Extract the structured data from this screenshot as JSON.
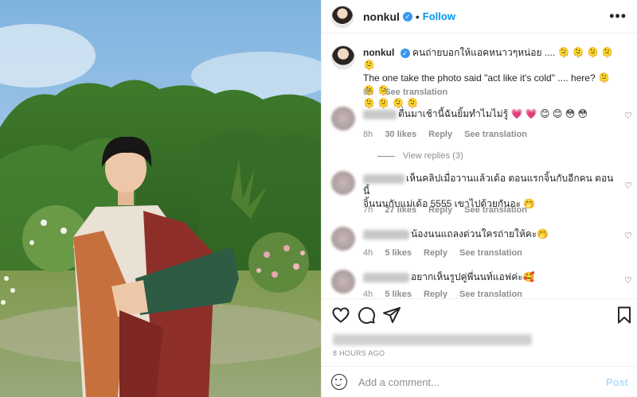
{
  "header": {
    "username": "nonkul",
    "verified_mark": "✓",
    "separator": "•",
    "follow_label": "Follow",
    "more_label": "•••"
  },
  "caption": {
    "username": "nonkul",
    "line1": "คนถ่ายบอกให้แอคหนาวๆหน่อย .... 🫠 🫠 🫠 🫠 🫠",
    "line2": "The one take the photo said \"act like it's cold\" .... here? 🫠 🫠 🫠",
    "line3": "🫠 🫠 🫠 🫠",
    "time": "8h",
    "see_translation": "See translation"
  },
  "comments": [
    {
      "text": "ตื่นมาเช้านี้ฉันยิ้มทำไมไม่รู้ 💗 💗 😊 😊 😳 😳",
      "time": "8h",
      "likes": "30 likes",
      "reply": "Reply",
      "see_translation": "See translation",
      "view_replies": "View replies (3)"
    },
    {
      "text": "เห็นคลิปเมื่อวานแล้วเด้อ ตอนแรกจิ้นกับอีกคน ตอนนี้",
      "text2": "จิ้นนนกับแม่เด้อ 5555 เขาไปด้วยกันอะ 🤭",
      "time": "7h",
      "likes": "27 likes",
      "reply": "Reply",
      "see_translation": "See translation"
    },
    {
      "text": "น้องนนแถลงด่วนใครถ่ายให้คะ🤭",
      "time": "4h",
      "likes": "5 likes",
      "reply": "Reply",
      "see_translation": "See translation"
    },
    {
      "text": "อยากเห็นรูปคู่พี่นนท์แอฟค่ะ🥰",
      "time": "4h",
      "likes": "5 likes",
      "reply": "Reply",
      "see_translation": "See translation"
    }
  ],
  "actions": {
    "icons": [
      "heart-icon",
      "comment-icon",
      "share-icon",
      "bookmark-icon"
    ],
    "timestamp": "8 HOURS AGO"
  },
  "add_comment": {
    "placeholder": "Add a comment...",
    "post_label": "Post"
  },
  "colors": {
    "accent": "#0095f6",
    "muted": "#8e8e8e",
    "text": "#262626"
  }
}
